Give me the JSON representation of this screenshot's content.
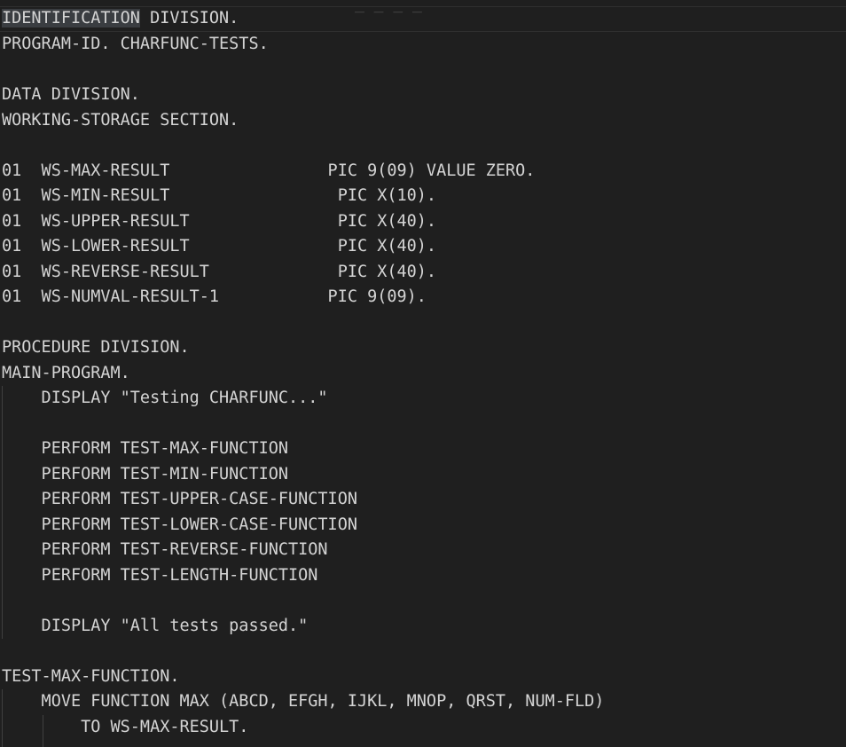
{
  "top_decor": "_ _ _ _",
  "lines": [
    {
      "text": "IDENTIFICATION",
      "rest": " DIVISION."
    },
    {
      "text": "PROGRAM-ID. CHARFUNC-TESTS."
    },
    {
      "text": ""
    },
    {
      "text": "DATA DIVISION."
    },
    {
      "text": "WORKING-STORAGE SECTION."
    },
    {
      "text": ""
    },
    {
      "text": "01  WS-MAX-RESULT                PIC 9(09) VALUE ZERO."
    },
    {
      "text": "01  WS-MIN-RESULT                 PIC X(10)."
    },
    {
      "text": "01  WS-UPPER-RESULT               PIC X(40)."
    },
    {
      "text": "01  WS-LOWER-RESULT               PIC X(40)."
    },
    {
      "text": "01  WS-REVERSE-RESULT             PIC X(40)."
    },
    {
      "text": "01  WS-NUMVAL-RESULT-1           PIC 9(09)."
    },
    {
      "text": ""
    },
    {
      "text": "PROCEDURE DIVISION."
    },
    {
      "text": "MAIN-PROGRAM."
    },
    {
      "text": "    DISPLAY \"Testing CHARFUNC...\""
    },
    {
      "text": ""
    },
    {
      "text": "    PERFORM TEST-MAX-FUNCTION"
    },
    {
      "text": "    PERFORM TEST-MIN-FUNCTION"
    },
    {
      "text": "    PERFORM TEST-UPPER-CASE-FUNCTION"
    },
    {
      "text": "    PERFORM TEST-LOWER-CASE-FUNCTION"
    },
    {
      "text": "    PERFORM TEST-REVERSE-FUNCTION"
    },
    {
      "text": "    PERFORM TEST-LENGTH-FUNCTION"
    },
    {
      "text": ""
    },
    {
      "text": "    DISPLAY \"All tests passed.\""
    },
    {
      "text": ""
    },
    {
      "text": "TEST-MAX-FUNCTION."
    },
    {
      "text": "    MOVE FUNCTION MAX (ABCD, EFGH, IJKL, MNOP, QRST, NUM-FLD)"
    },
    {
      "text": "        TO WS-MAX-RESULT."
    }
  ],
  "colors": {
    "background": "#1f1f1f",
    "text": "#d4d4d4",
    "selection_highlight": "#3a3d41",
    "indent_guide": "#404040"
  }
}
